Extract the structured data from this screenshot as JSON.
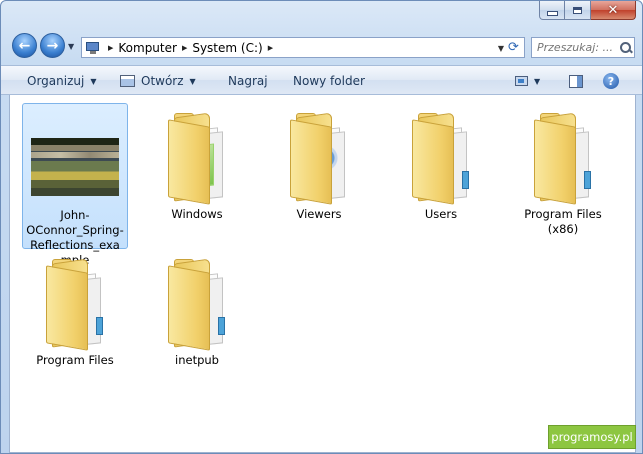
{
  "window": {
    "caption": {
      "minimize": "minimize",
      "maximize": "maximize",
      "close": "close"
    }
  },
  "nav": {
    "breadcrumb": [
      "Komputer",
      "System (C:)"
    ],
    "search_placeholder": "Przeszukaj: ..."
  },
  "toolbar": {
    "organize": "Organizuj",
    "open": "Otwórz",
    "burn": "Nagraj",
    "new_folder": "Nowy folder"
  },
  "items": [
    {
      "label": "John-OConnor_Spring-Reflections_example",
      "type": "image",
      "selected": true
    },
    {
      "label": "Windows",
      "type": "folder"
    },
    {
      "label": "Viewers",
      "type": "folder"
    },
    {
      "label": "Users",
      "type": "folder"
    },
    {
      "label": "Program Files (x86)",
      "type": "folder"
    },
    {
      "label": "Program Files",
      "type": "folder"
    },
    {
      "label": "inetpub",
      "type": "folder"
    }
  ],
  "watermark": "programosy.pl"
}
